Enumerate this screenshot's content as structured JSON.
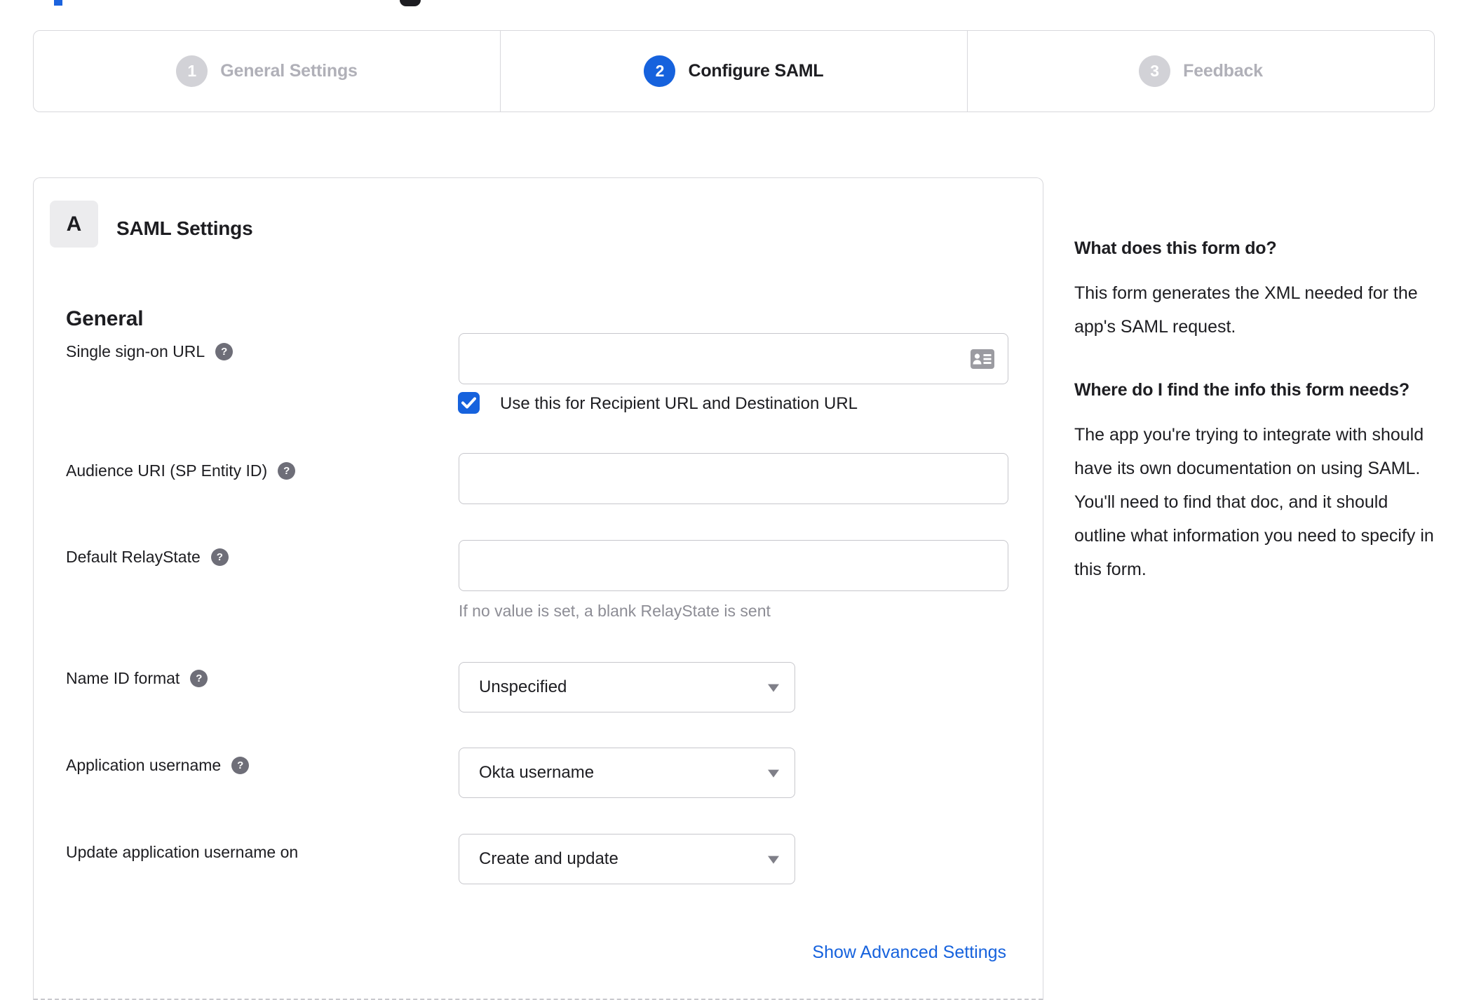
{
  "colors": {
    "accent_blue": "#1662dd",
    "text_dark": "#1d1d21",
    "muted_gray": "#8d8d95",
    "inactive_gray": "#b0b0b8",
    "border_gray": "#d8d8dc"
  },
  "stepper": {
    "steps": [
      {
        "number": "1",
        "label": "General Settings",
        "state": "inactive"
      },
      {
        "number": "2",
        "label": "Configure SAML",
        "state": "active"
      },
      {
        "number": "3",
        "label": "Feedback",
        "state": "inactive"
      }
    ]
  },
  "saml_panel": {
    "badge": "A",
    "title": "SAML Settings",
    "section": "General",
    "fields": {
      "sso_url": {
        "label": "Single sign-on URL",
        "value": "",
        "checkbox_checked": true,
        "checkbox_label": "Use this for Recipient URL and Destination URL"
      },
      "audience_uri": {
        "label": "Audience URI (SP Entity ID)",
        "value": ""
      },
      "default_relay_state": {
        "label": "Default RelayState",
        "value": "",
        "hint": "If no value is set, a blank RelayState is sent"
      },
      "name_id_format": {
        "label": "Name ID format",
        "value": "Unspecified"
      },
      "application_username": {
        "label": "Application username",
        "value": "Okta username"
      },
      "update_app_username": {
        "label": "Update application username on",
        "value": "Create and update"
      }
    },
    "advanced_link": "Show Advanced Settings"
  },
  "help_panel": {
    "q1": {
      "heading": "What does this form do?",
      "body": "This form generates the XML needed for the app's SAML request."
    },
    "q2": {
      "heading": "Where do I find the info this form needs?",
      "body": "The app you're trying to integrate with should have its own documentation on using SAML. You'll need to find that doc, and it should outline what information you need to specify in this form."
    }
  }
}
